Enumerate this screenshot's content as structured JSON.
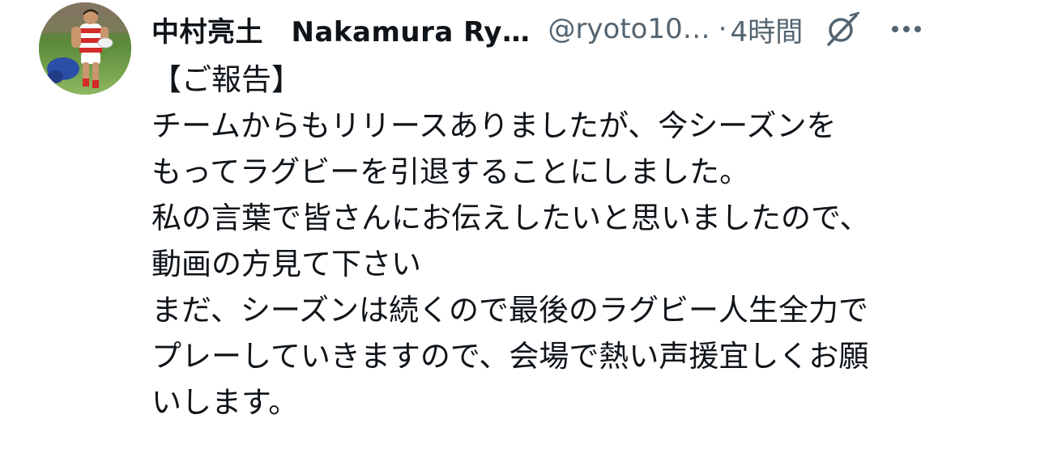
{
  "tweet": {
    "display_name": "中村亮土　Nakamura Ry…",
    "handle": "@ryoto10…",
    "separator": "·",
    "time": "4時間",
    "grok_icon": "grok-slash-circle-icon",
    "more_icon": "more-dots-icon",
    "avatar_icon": "rugby-player-avatar",
    "body_lines": [
      "【ご報告】",
      "チームからもリリースありましたが、今シーズンを",
      "もってラグビーを引退することにしました。",
      "私の言葉で皆さんにお伝えしたいと思いましたので、",
      "動画の方見て下さい",
      "まだ、シーズンは続くので最後のラグビー人生全力で",
      "プレーしていきますので、会場で熱い声援宜しくお願",
      "いします。"
    ]
  },
  "colors": {
    "text_primary": "#0f1419",
    "text_secondary": "#536471",
    "background": "#ffffff"
  }
}
